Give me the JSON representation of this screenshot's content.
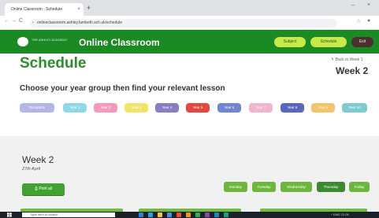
{
  "browser": {
    "tab_title": "Online Classroom - Schedule",
    "tab_close": "×",
    "new_tab": "+",
    "min": "–",
    "close": "×",
    "back": "←",
    "forward": "→",
    "reload": "C",
    "url": "onlineclassroom.ashley.lambeth.sch.uk/schedule",
    "star": "☆",
    "profile": "●"
  },
  "header": {
    "logo_text": "THE ASHLEY ACADEMY",
    "title": "Online Classroom",
    "buttons": [
      {
        "label": "Subject"
      },
      {
        "label": "Schedule"
      },
      {
        "label": "Exit"
      }
    ]
  },
  "schedule": {
    "title": "Schedule",
    "back_link": "Back to Week 1",
    "week_heading": "Week 2",
    "instruction": "Choose your year group then find your relevant lesson"
  },
  "year_groups": [
    {
      "label": "Reception",
      "color": "#b3b5e6"
    },
    {
      "label": "Year 1",
      "color": "#8fd8ea"
    },
    {
      "label": "Year 2",
      "color": "#f59abf"
    },
    {
      "label": "Year 3",
      "color": "#f3e36a"
    },
    {
      "label": "Year 4",
      "color": "#8a7dc4"
    },
    {
      "label": "Year 5",
      "color": "#e5473f"
    },
    {
      "label": "Year 6",
      "color": "#6f86d3"
    },
    {
      "label": "Year 7",
      "color": "#f2b4cf"
    },
    {
      "label": "Year 8",
      "color": "#5968bf"
    },
    {
      "label": "Year 9",
      "color": "#f5c46a"
    },
    {
      "label": "Year 10",
      "color": "#7fcbd1"
    }
  ],
  "week": {
    "title": "Week 2",
    "date": "27th April",
    "print_label": "Print all",
    "days": [
      {
        "label": "Monday",
        "active": false
      },
      {
        "label": "Tuesday",
        "active": false
      },
      {
        "label": "Wednesday",
        "active": false
      },
      {
        "label": "Thursday",
        "active": true
      },
      {
        "label": "Friday",
        "active": false
      }
    ]
  },
  "taskbar": {
    "search_placeholder": "Type here to search",
    "tray_text": "^  ENG  12:00"
  },
  "colors": {
    "brand_green": "#1b8a25",
    "title_green": "#2e8b2e"
  }
}
